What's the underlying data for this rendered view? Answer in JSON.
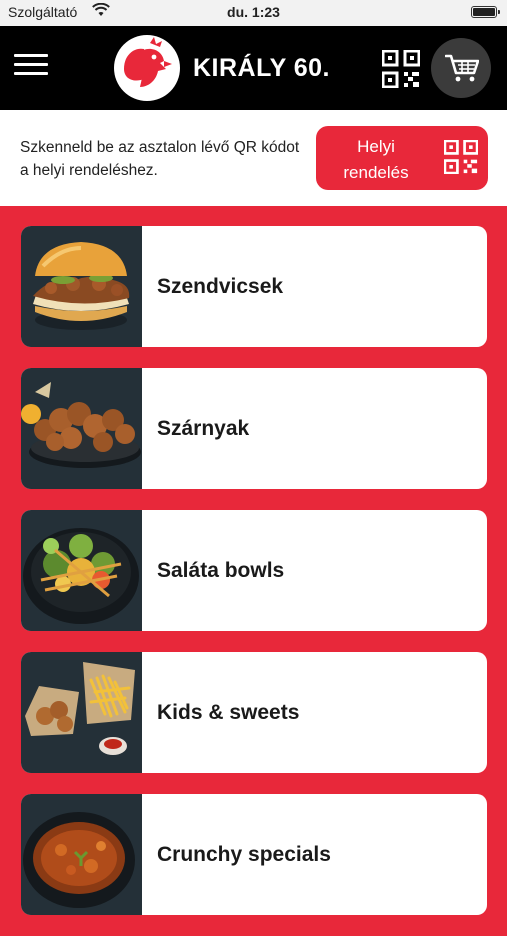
{
  "status_bar": {
    "carrier": "Szolgáltató",
    "time": "du. 1:23"
  },
  "header": {
    "brand": "KIRÁLY 60."
  },
  "scan": {
    "text": "Szkenneld be az asztalon lévő QR kódot a helyi rendeléshez.",
    "button_line1": "Helyi",
    "button_line2": "rendelés"
  },
  "categories": [
    {
      "label": "Szendvicsek"
    },
    {
      "label": "Szárnyak"
    },
    {
      "label": "Saláta bowls"
    },
    {
      "label": "Kids & sweets"
    },
    {
      "label": "Crunchy specials"
    }
  ],
  "colors": {
    "brand_red": "#e8283a",
    "header_bg": "#000000",
    "cart_bg": "#3b3b3b"
  }
}
